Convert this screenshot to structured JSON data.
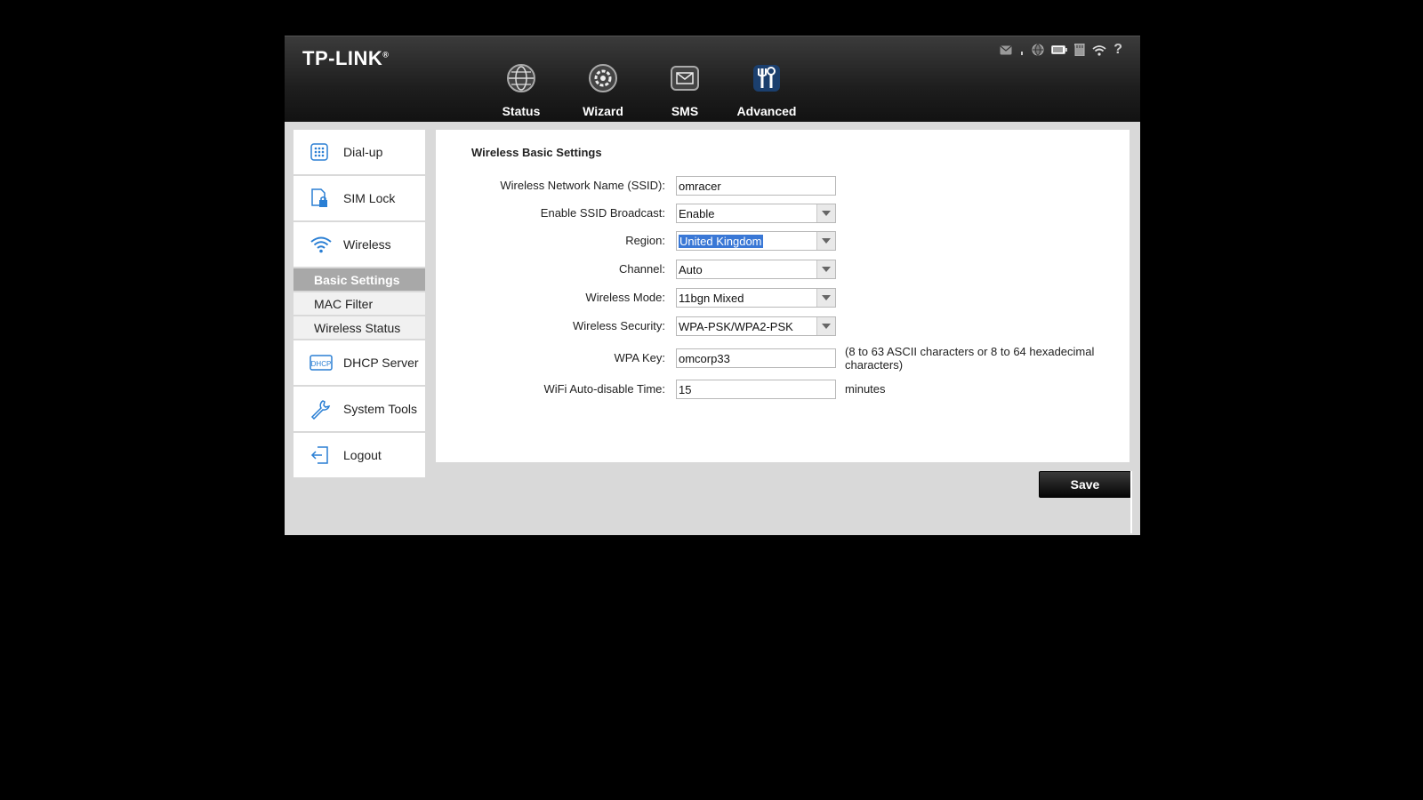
{
  "brand": {
    "name": "TP-LINK",
    "mark": "®"
  },
  "nav": [
    {
      "label": "Status",
      "icon": "globe-icon"
    },
    {
      "label": "Wizard",
      "icon": "gear-icon"
    },
    {
      "label": "SMS",
      "icon": "envelope-icon"
    },
    {
      "label": "Advanced",
      "icon": "tools-icon"
    }
  ],
  "status_icons": [
    "mail-icon",
    "signal-icon",
    "internet-icon",
    "battery-icon",
    "sd-card-icon",
    "wifi-icon"
  ],
  "help_label": "?",
  "sidebar": {
    "items": [
      {
        "label": "Dial-up",
        "icon": "dialpad-icon"
      },
      {
        "label": "SIM Lock",
        "icon": "sim-lock-icon"
      },
      {
        "label": "Wireless",
        "icon": "wifi-icon"
      },
      {
        "label": "DHCP Server",
        "icon": "dhcp-icon"
      },
      {
        "label": "System Tools",
        "icon": "wrench-icon"
      },
      {
        "label": "Logout",
        "icon": "logout-icon"
      }
    ],
    "wireless_sub": [
      {
        "label": "Basic Settings",
        "active": true
      },
      {
        "label": "MAC Filter",
        "active": false
      },
      {
        "label": "Wireless Status",
        "active": false
      }
    ]
  },
  "form": {
    "title": "Wireless Basic Settings",
    "ssid": {
      "label": "Wireless Network Name (SSID):",
      "value": "omracer"
    },
    "broadcast": {
      "label": "Enable SSID Broadcast:",
      "value": "Enable"
    },
    "region": {
      "label": "Region:",
      "value": "United Kingdom"
    },
    "channel": {
      "label": "Channel:",
      "value": "Auto"
    },
    "mode": {
      "label": "Wireless Mode:",
      "value": "11bgn Mixed"
    },
    "security": {
      "label": "Wireless Security:",
      "value": "WPA-PSK/WPA2-PSK"
    },
    "wpa_key": {
      "label": "WPA Key:",
      "value": "omcorp33",
      "note": "(8 to 63 ASCII characters or 8 to 64 hexadecimal characters)"
    },
    "auto_disable": {
      "label": "WiFi Auto-disable Time:",
      "value": "15",
      "unit": "minutes"
    }
  },
  "save_label": "Save",
  "colors": {
    "accent": "#3a78d6",
    "header_dark": "#1e1e1e",
    "icon_blue": "#2a7fd4"
  }
}
